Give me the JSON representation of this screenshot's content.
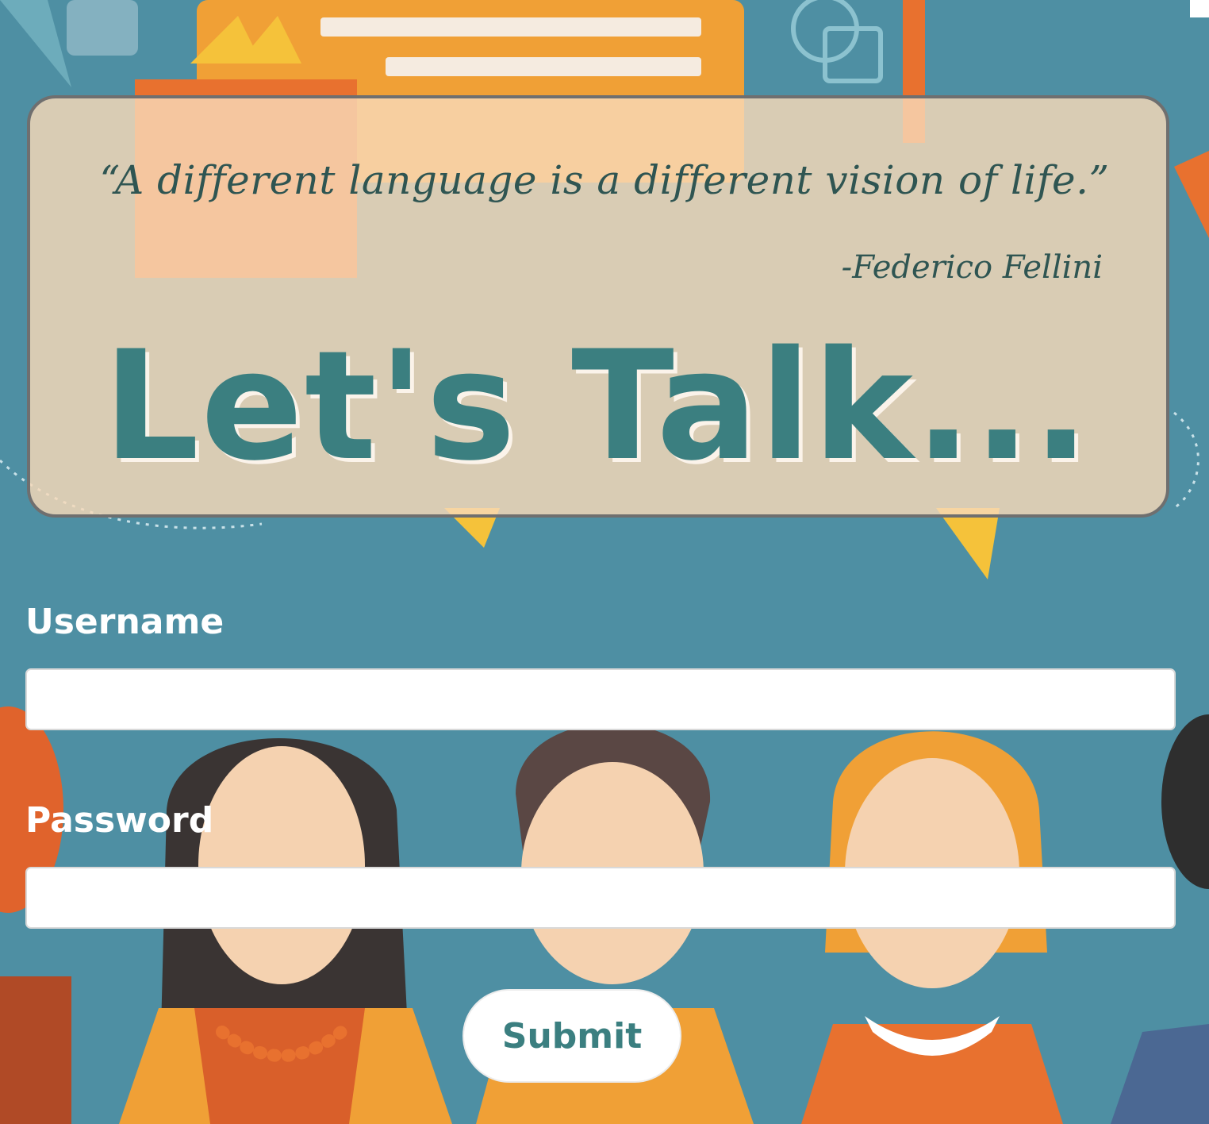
{
  "hero": {
    "quote": "“A different language is a different vision of life.”",
    "attribution": "-Federico Fellini",
    "headline": "Let's Talk..."
  },
  "form": {
    "username_label": "Username",
    "username_value": "",
    "password_label": "Password",
    "password_value": "",
    "submit_label": "Submit"
  },
  "colors": {
    "background": "#4e8fa3",
    "card": "#f8d9b8",
    "headline": "#3b7f80",
    "quote_text": "#2f5552",
    "orange_accent": "#f0a036",
    "dark_orange": "#e8712f"
  }
}
